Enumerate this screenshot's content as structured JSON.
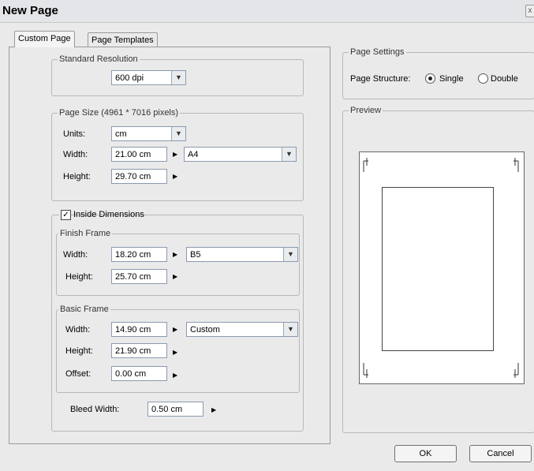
{
  "window": {
    "title": "New Page",
    "close_glyph": "x"
  },
  "tabs": [
    {
      "label": "Custom Page",
      "active": true
    },
    {
      "label": "Page Templates",
      "active": false
    }
  ],
  "standard_resolution": {
    "legend": "Standard Resolution",
    "value": "600 dpi"
  },
  "page_size": {
    "legend": "Page Size (4961 * 7016 pixels)",
    "units_label": "Units:",
    "units_value": "cm",
    "width_label": "Width:",
    "width_value": "21.00 cm",
    "height_label": "Height:",
    "height_value": "29.70 cm",
    "preset": "A4"
  },
  "inside_dimensions": {
    "checkbox_label": "Inside Dimensions",
    "checked": true,
    "finish_frame": {
      "legend": "Finish Frame",
      "width_label": "Width:",
      "width_value": "18.20 cm",
      "height_label": "Height:",
      "height_value": "25.70 cm",
      "preset": "B5"
    },
    "basic_frame": {
      "legend": "Basic Frame",
      "width_label": "Width:",
      "width_value": "14.90 cm",
      "height_label": "Height:",
      "height_value": "21.90 cm",
      "offset_label": "Offset:",
      "offset_value": "0.00 cm",
      "preset": "Custom"
    },
    "bleed_label": "Bleed Width:",
    "bleed_value": "0.50 cm"
  },
  "page_settings": {
    "legend": "Page Settings",
    "structure_label": "Page Structure:",
    "options": [
      {
        "label": "Single",
        "selected": true
      },
      {
        "label": "Double",
        "selected": false
      }
    ]
  },
  "preview": {
    "legend": "Preview"
  },
  "buttons": {
    "ok": "OK",
    "cancel": "Cancel"
  },
  "icons": {
    "dropdown": "chevron-down-icon",
    "arrow": "triangle-right-icon"
  }
}
